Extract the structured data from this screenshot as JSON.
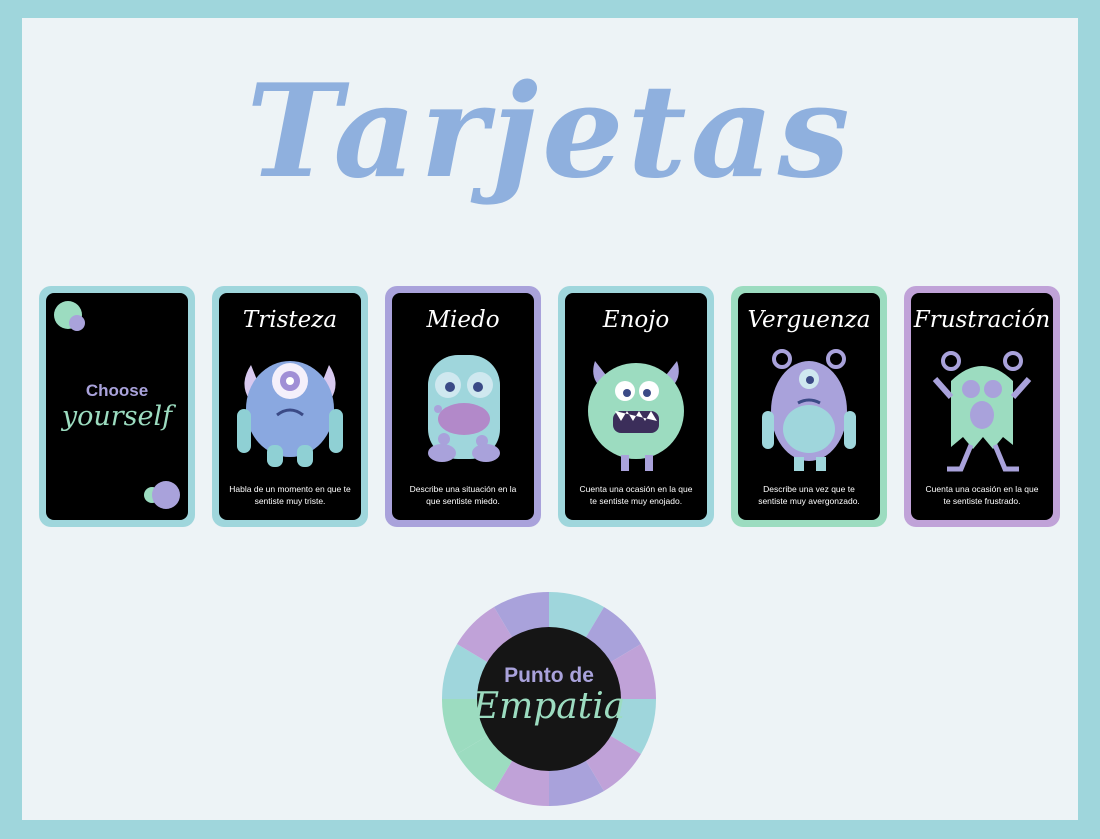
{
  "title": "Tarjetas",
  "colors": {
    "teal": "#9fd6dc",
    "purple": "#a9a2db",
    "mint": "#9cdcc0",
    "blue_title": "#8fb0de",
    "background": "#edf3f6"
  },
  "cover_card": {
    "line1": "Choose",
    "line2": "yourself"
  },
  "cards": [
    {
      "title": "Tristeza",
      "text": "Habla de un momento en que te sentiste muy triste.",
      "border": "#9fd6dc",
      "monster": "sad-monster-icon"
    },
    {
      "title": "Miedo",
      "text": "Describe una situación en la que sentiste miedo.",
      "border": "#a9a2db",
      "monster": "scared-monster-icon"
    },
    {
      "title": "Enojo",
      "text": "Cuenta una ocasión en la que te sentiste muy enojado.",
      "border": "#9fd6dc",
      "monster": "angry-monster-icon"
    },
    {
      "title": "Verguenza",
      "text": "Describe una vez que te sentiste muy avergonzado.",
      "border": "#9cdcc0",
      "monster": "ashamed-monster-icon"
    },
    {
      "title": "Frustración",
      "text": "Cuenta una ocasión en la que te sentiste frustrado.",
      "border": "#c0a2d8",
      "monster": "frustrated-monster-icon"
    }
  ],
  "logo": {
    "line1": "Punto de",
    "line2": "Empatia"
  }
}
